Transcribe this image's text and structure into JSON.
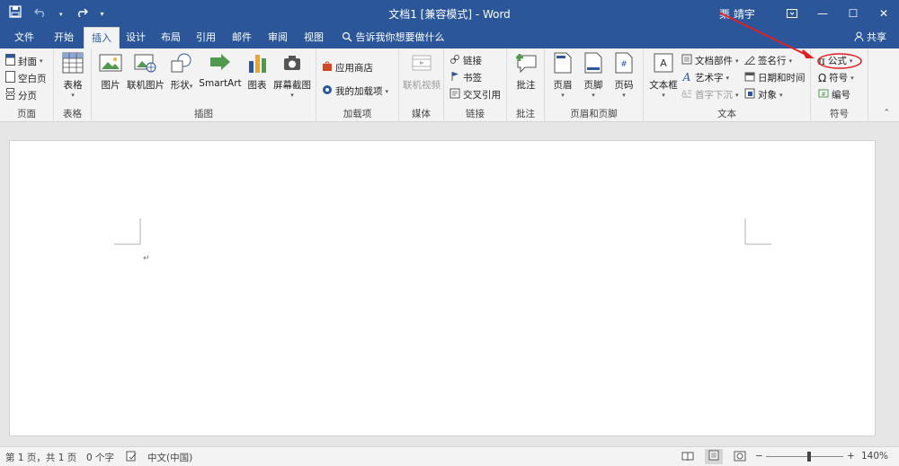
{
  "titlebar": {
    "title": "文档1 [兼容模式] - Word",
    "user": "栗 靖宇",
    "save_icon": "save-icon",
    "undo_icon": "undo-icon",
    "redo_icon": "redo-icon",
    "customize_icon": "customize-qat-icon"
  },
  "tabs": {
    "items": [
      "文件",
      "开始",
      "插入",
      "设计",
      "布局",
      "引用",
      "邮件",
      "审阅",
      "视图"
    ],
    "tell_me": "告诉我你想要做什么",
    "share": "共享"
  },
  "ribbon": {
    "pages": {
      "label": "页面",
      "cover": "封面",
      "blank": "空白页",
      "break": "分页"
    },
    "tables": {
      "label": "表格",
      "table": "表格"
    },
    "illustrations": {
      "label": "插图",
      "picture": "图片",
      "online_picture": "联机图片",
      "shapes": "形状",
      "smartart": "SmartArt",
      "chart": "图表",
      "screenshot": "屏幕截图"
    },
    "addins": {
      "label": "加载项",
      "store": "应用商店",
      "my_addins": "我的加载项"
    },
    "media": {
      "label": "媒体",
      "online_video": "联机视频"
    },
    "links": {
      "label": "链接",
      "link": "链接",
      "bookmark": "书签",
      "cross_ref": "交叉引用"
    },
    "comments": {
      "label": "批注",
      "comment": "批注"
    },
    "header_footer": {
      "label": "页眉和页脚",
      "header": "页眉",
      "footer": "页脚",
      "page_number": "页码"
    },
    "text": {
      "label": "文本",
      "textbox": "文本框",
      "quick_parts": "文档部件",
      "wordart": "艺术字",
      "dropcap": "首字下沉",
      "signature": "签名行",
      "datetime": "日期和时间",
      "object": "对象"
    },
    "symbols": {
      "label": "符号",
      "equation": "公式",
      "symbol": "符号",
      "number": "编号"
    }
  },
  "statusbar": {
    "page": "第 1 页，共 1 页",
    "words": "0 个字",
    "language": "中文(中国)",
    "zoom": "140%"
  },
  "colors": {
    "accent": "#2b579a",
    "annotation": "#e02020"
  }
}
